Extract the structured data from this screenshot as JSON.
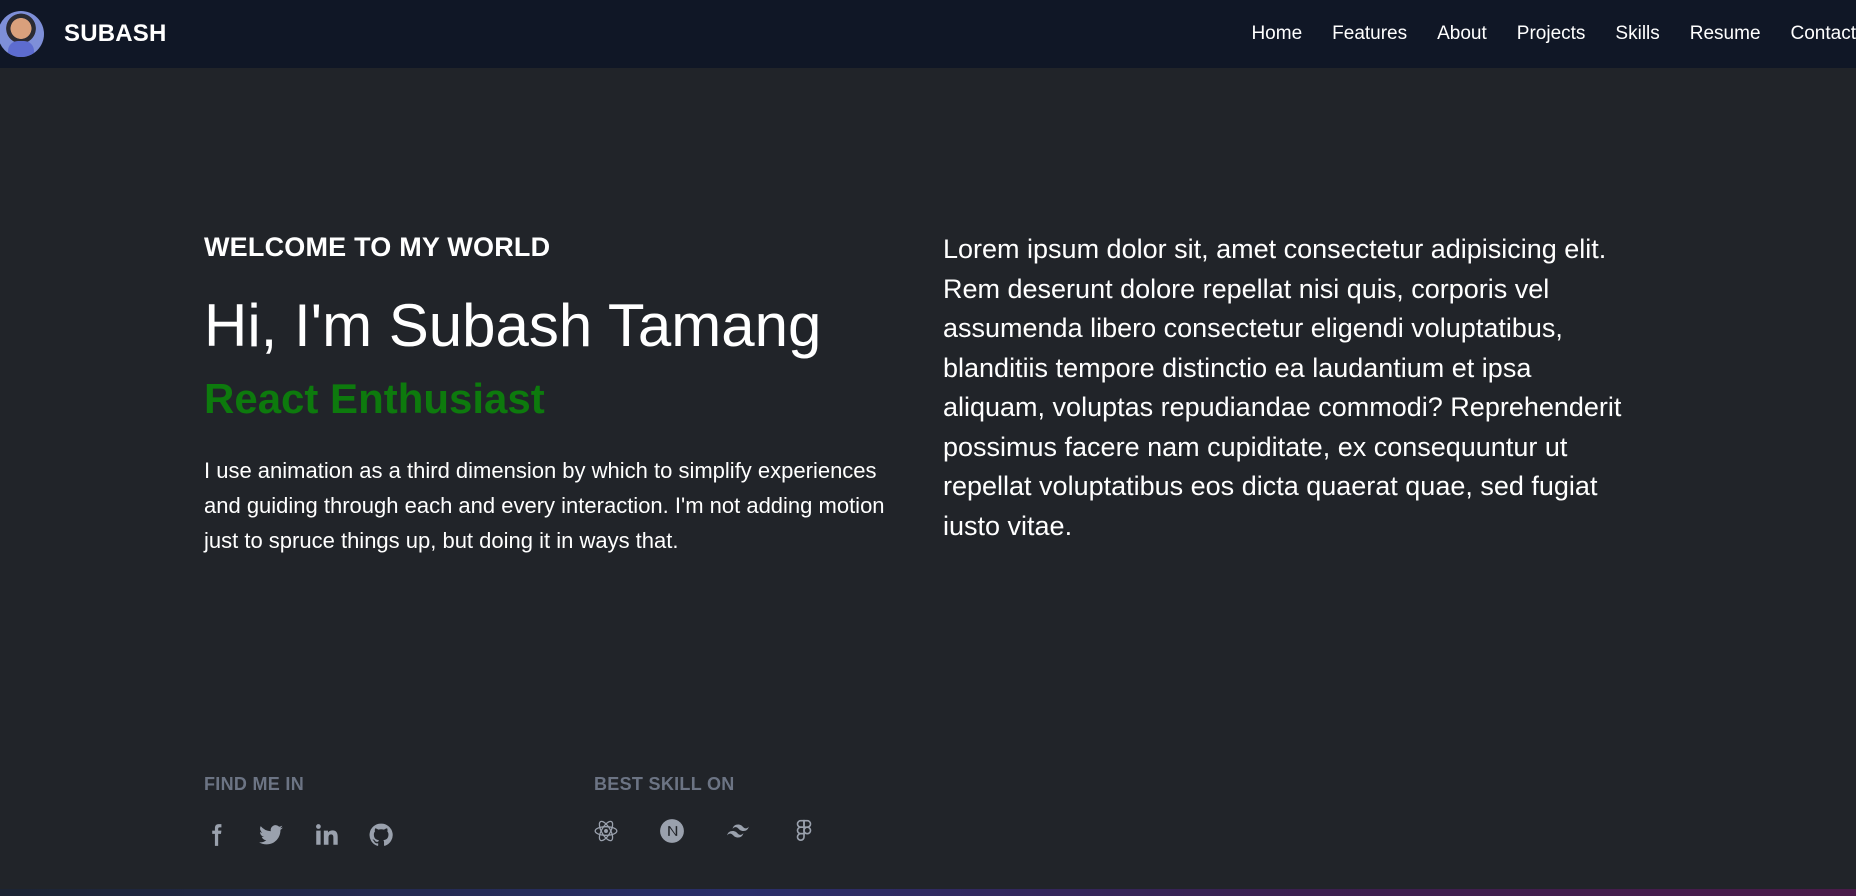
{
  "navbar": {
    "brand": "SUBASH",
    "links": [
      "Home",
      "Features",
      "About",
      "Projects",
      "Skills",
      "Resume",
      "Contact"
    ]
  },
  "hero": {
    "welcome": "WELCOME TO MY WORLD",
    "title": "Hi, I'm Subash Tamang",
    "role": "React Enthusiast",
    "description": "I use animation as a third dimension by which to simplify experiences and guiding through each and every interaction. I'm not adding motion just to spruce things up, but doing it in ways that.",
    "lorem": "Lorem ipsum dolor sit, amet consectetur adipisicing elit. Rem deserunt dolore repellat nisi quis, corporis vel assumenda libero consectetur eligendi voluptatibus, blanditiis tempore distinctio ea laudantium et ipsa aliquam, voluptas repudiandae commodi? Reprehenderit possimus facere nam cupiditate, ex consequuntur ut repellat voluptatibus eos dicta quaerat quae, sed fugiat iusto vitae."
  },
  "find_me": {
    "label": "FIND ME IN",
    "icons": [
      "facebook-icon",
      "twitter-icon",
      "linkedin-icon",
      "github-icon"
    ]
  },
  "best_skill": {
    "label": "BEST SKILL ON",
    "icons": [
      "react-icon",
      "nextjs-icon",
      "tailwind-icon",
      "figma-icon"
    ]
  },
  "colors": {
    "background": "#212429",
    "navbar": "#101726",
    "role_text": "#0d7a0d",
    "muted_label": "#6c7484",
    "icon": "#9aa1ad"
  }
}
